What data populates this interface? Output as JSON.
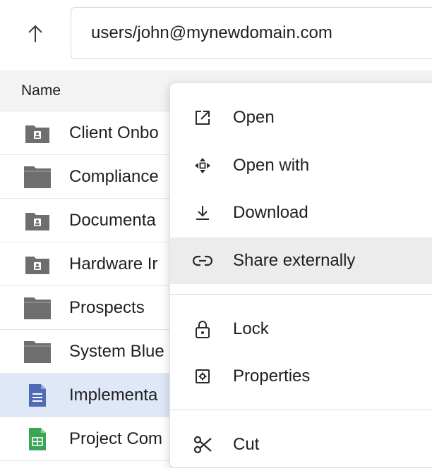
{
  "nav": {
    "up_icon": "arrow-up-icon",
    "path": "users/john@mynewdomain.com"
  },
  "list": {
    "header_name": "Name",
    "rows": [
      {
        "name": "Client Onbo",
        "icon": "shared-folder-icon",
        "selected": false
      },
      {
        "name": "Compliance",
        "icon": "folder-icon",
        "selected": false
      },
      {
        "name": "Documenta",
        "icon": "shared-folder-icon",
        "selected": false
      },
      {
        "name": "Hardware Ir",
        "icon": "shared-folder-icon",
        "selected": false
      },
      {
        "name": "Prospects",
        "icon": "folder-icon",
        "selected": false
      },
      {
        "name": "System Blue",
        "icon": "folder-icon",
        "selected": false
      },
      {
        "name": "Implementa",
        "icon": "document-icon",
        "selected": true
      },
      {
        "name": "Project Com",
        "icon": "spreadsheet-icon",
        "selected": false
      }
    ]
  },
  "menu": {
    "items": [
      {
        "label": "Open",
        "icon": "open-external-icon"
      },
      {
        "label": "Open with",
        "icon": "move-arrows-icon"
      },
      {
        "label": "Download",
        "icon": "download-icon"
      },
      {
        "label": "Share externally",
        "icon": "link-icon",
        "highlighted": true
      },
      {
        "label": "Lock",
        "icon": "lock-icon"
      },
      {
        "label": "Properties",
        "icon": "properties-icon"
      },
      {
        "label": "Cut",
        "icon": "scissors-icon"
      }
    ]
  },
  "colors": {
    "selected_row": "#dfe8f6",
    "menu_hover": "#ececec",
    "folder_gray": "#6e6e6e",
    "doc_blue": "#4f6bb8",
    "sheet_green": "#3aa655"
  }
}
